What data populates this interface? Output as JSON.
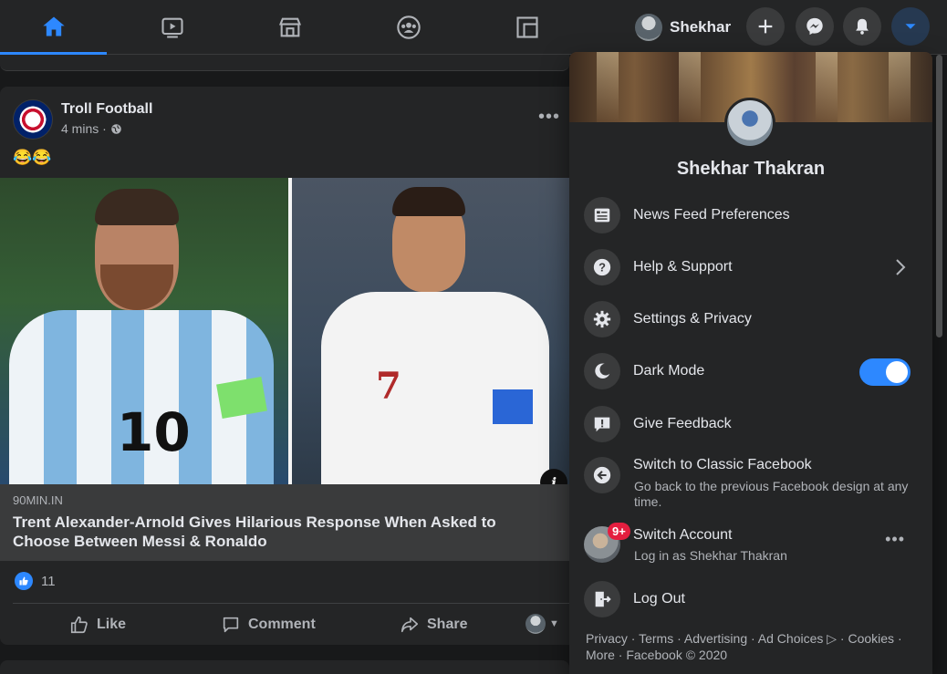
{
  "topbar": {
    "nav": [
      {
        "name": "home",
        "icon": "home-icon"
      },
      {
        "name": "watch",
        "icon": "video-icon"
      },
      {
        "name": "marketplace",
        "icon": "shop-icon"
      },
      {
        "name": "groups",
        "icon": "groups-icon"
      },
      {
        "name": "gaming",
        "icon": "gaming-icon"
      }
    ],
    "profile_name": "Shekhar",
    "buttons": [
      "plus-icon",
      "messenger-icon",
      "bell-icon",
      "caret-down-icon"
    ],
    "accent": "#2d88ff"
  },
  "post": {
    "page_name": "Troll Football",
    "time": "4 mins ·",
    "privacy_icon": "globe-icon",
    "text": "😂😂",
    "link": {
      "domain": "90MIN.IN",
      "title": "Trent Alexander-Arnold Gives Hilarious Response When Asked to Choose Between Messi & Ronaldo"
    },
    "photo_labels": {
      "left_number": "10",
      "right_number": "7"
    },
    "reactions_count": "11",
    "actions": {
      "like": "Like",
      "comment": "Comment",
      "share": "Share"
    }
  },
  "menu": {
    "name": "Shekhar Thakran",
    "items": [
      {
        "label": "News Feed Preferences",
        "icon": "news-feed-icon"
      },
      {
        "label": "Help & Support",
        "icon": "help-icon"
      },
      {
        "label": "Settings & Privacy",
        "icon": "gear-icon"
      },
      {
        "label": "Dark Mode",
        "icon": "moon-icon",
        "toggle_on": true
      },
      {
        "label": "Give Feedback",
        "icon": "feedback-icon"
      },
      {
        "label": "Switch to Classic Facebook",
        "sub": "Go back to the previous Facebook design at any time.",
        "icon": "arrow-left-icon"
      },
      {
        "label": "Switch Account",
        "sub": "Log in as Shekhar Thakran",
        "badge": "9+"
      },
      {
        "label": "Log Out",
        "icon": "logout-icon"
      }
    ],
    "footer": "Privacy · Terms · Advertising · Ad Choices ▷ · Cookies · More · Facebook © 2020"
  }
}
